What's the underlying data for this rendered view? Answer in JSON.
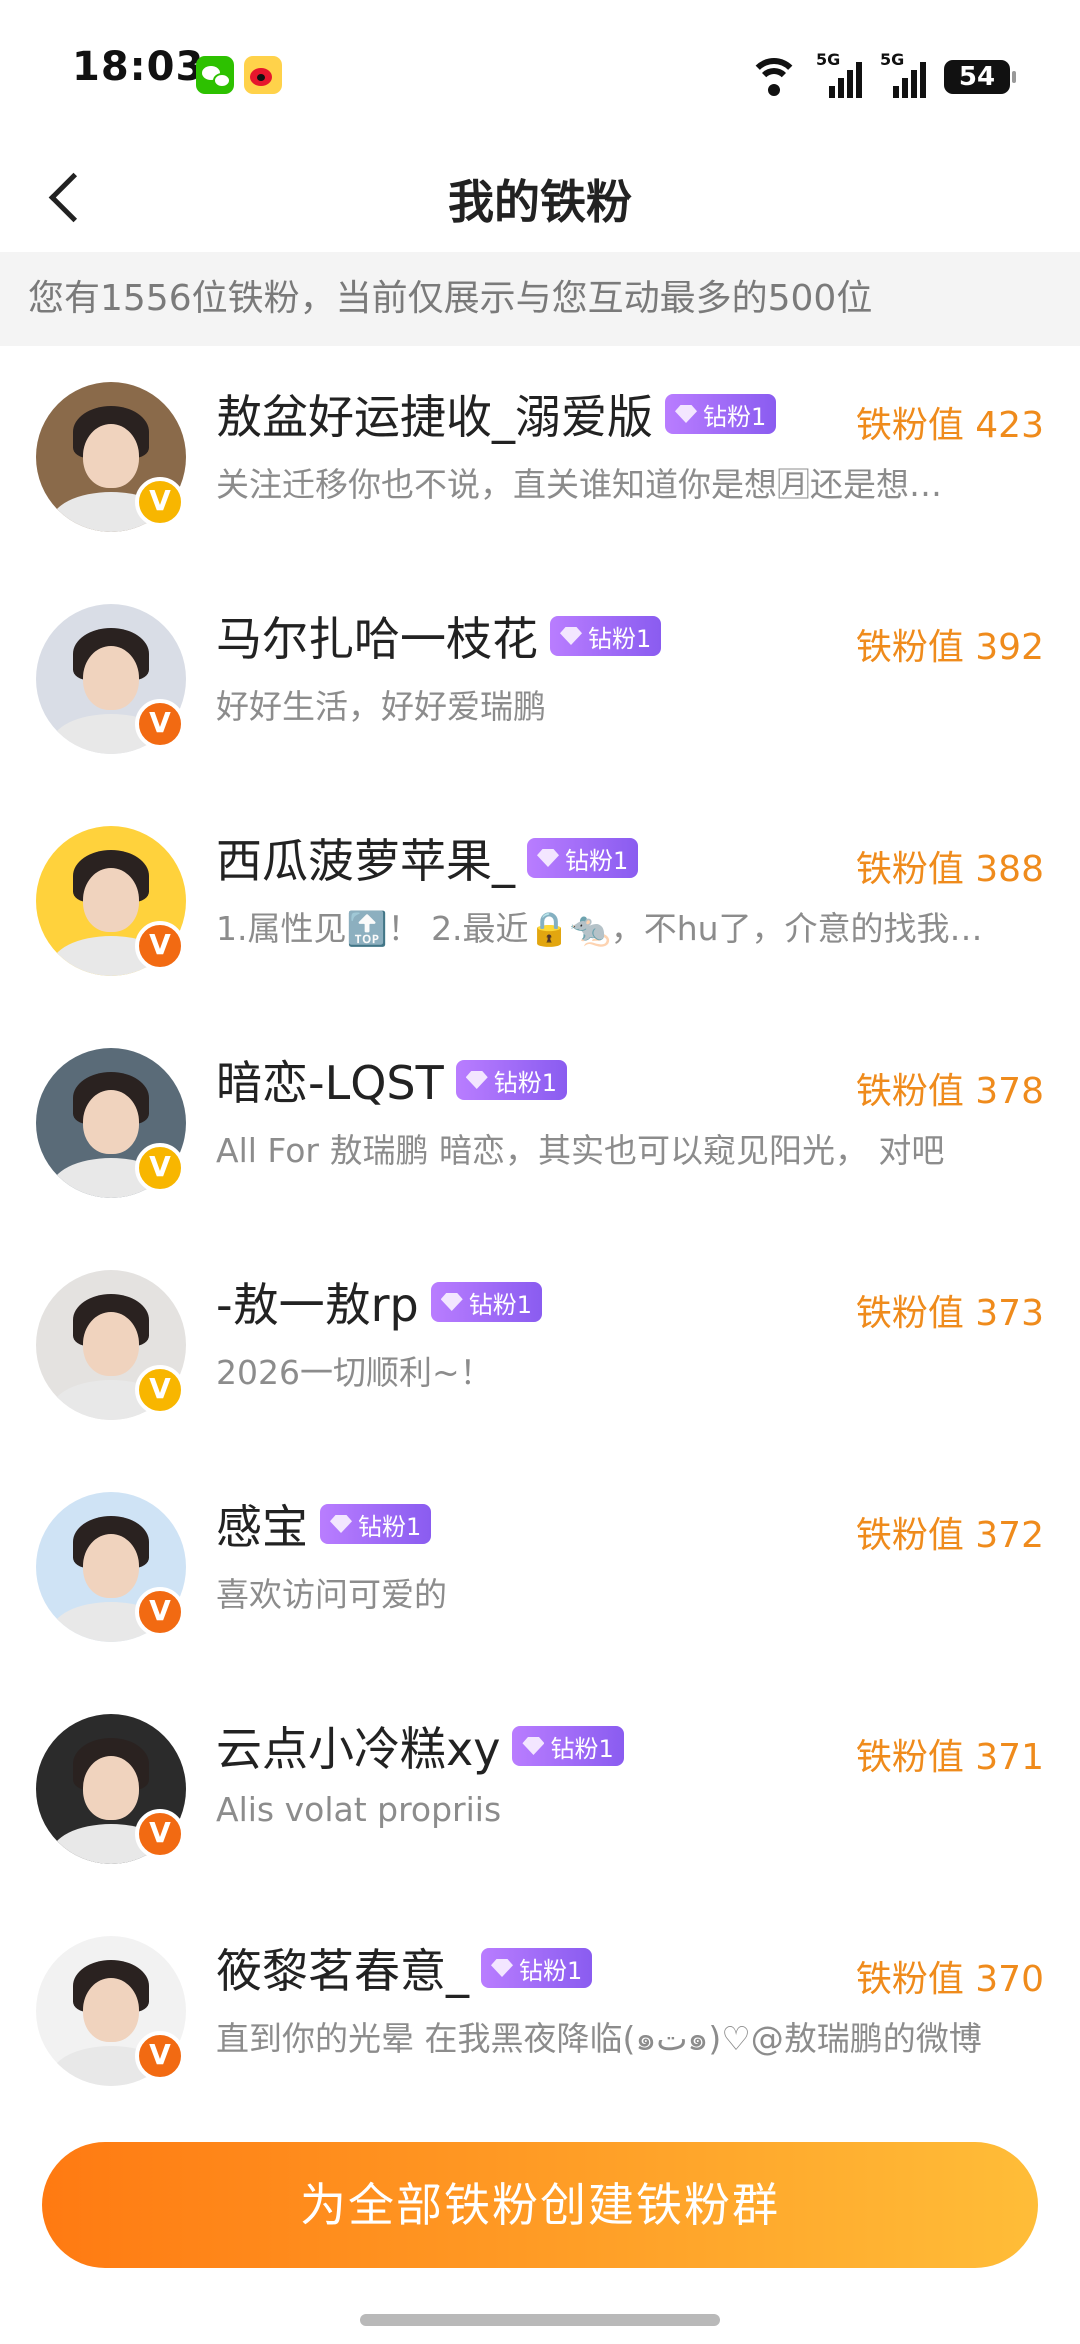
{
  "status_bar": {
    "time": "18:03",
    "apps": [
      "wechat-icon",
      "weibo-icon"
    ],
    "signal_tags": [
      "5G",
      "5G"
    ],
    "battery": "54"
  },
  "nav": {
    "back_icon": "chevron-left-icon",
    "title": "我的铁粉"
  },
  "banner": {
    "text": "您有1556位铁粉，当前仅展示与您互动最多的500位"
  },
  "colors": {
    "accent": "#ef8b1c",
    "badge_purple": "#9b6cf6",
    "button_start": "#ff7a12",
    "button_end": "#ffbd38",
    "verify_yellow": "#f8b600",
    "verify_orange": "#f26a12"
  },
  "fans": [
    {
      "name": "敖盆好运捷收_溺爱版",
      "badge": "钻粉1",
      "score": "铁粉值 423",
      "bio": "关注迁移你也不说，直关谁知道你是想🈷还是想…",
      "verified": "yellow",
      "avatar_bg": "#8a6a4a"
    },
    {
      "name": "马尔扎哈一枝花",
      "badge": "钻粉1",
      "score": "铁粉值 392",
      "bio": "好好生活，好好爱瑞鹏",
      "verified": "orange",
      "avatar_bg": "#d9dde6"
    },
    {
      "name": "西瓜菠萝苹果_",
      "badge": "钻粉1",
      "score": "铁粉值 388",
      "bio": "1.属性见🔝！ 2.最近🔒🐀，不hu了，介意的找我…",
      "verified": "orange",
      "avatar_bg": "#ffd23c"
    },
    {
      "name": "暗恋-LQST",
      "badge": "钻粉1",
      "score": "铁粉值 378",
      "bio": "All For 敖瑞鹏 暗恋，其实也可以窥见阳光， 对吧",
      "verified": "yellow",
      "avatar_bg": "#5a6b78"
    },
    {
      "name": "-敖一敖rp",
      "badge": "钻粉1",
      "score": "铁粉值 373",
      "bio": "2026一切顺利~！",
      "verified": "yellow",
      "avatar_bg": "#e4e2e0"
    },
    {
      "name": "感宝",
      "badge": "钻粉1",
      "score": "铁粉值 372",
      "bio": "喜欢访问可爱的",
      "verified": "orange",
      "avatar_bg": "#cfe3f5"
    },
    {
      "name": "云点小冷糕xy",
      "badge": "钻粉1",
      "score": "铁粉值 371",
      "bio": "Alis volat propriis",
      "verified": "orange",
      "avatar_bg": "#2b2b2b"
    },
    {
      "name": "筱黎茗春意_",
      "badge": "钻粉1",
      "score": "铁粉值 370",
      "bio": "直到你的光晕 在我黑夜降临(๑ت๑)♡@敖瑞鹏的微博",
      "verified": "orange",
      "avatar_bg": "#f2f2f2"
    }
  ],
  "bottom": {
    "create_button": "为全部铁粉创建铁粉群"
  }
}
